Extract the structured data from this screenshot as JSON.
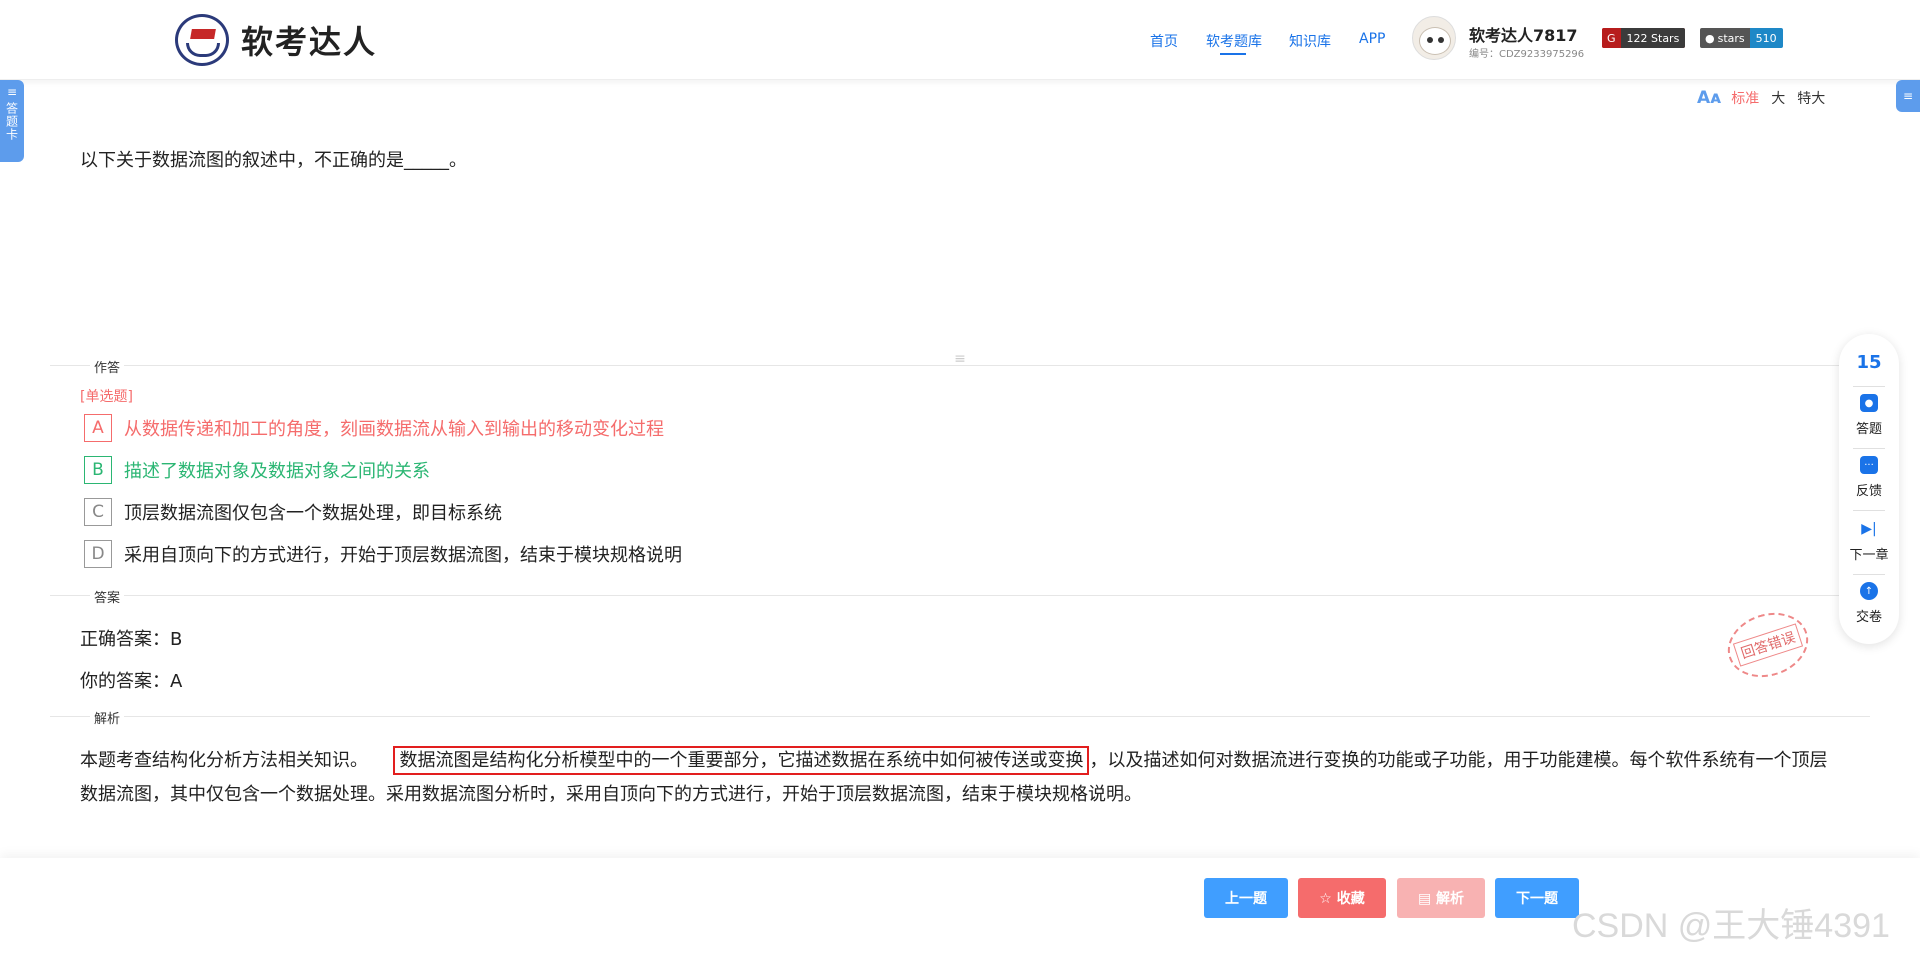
{
  "header": {
    "logo_text": "软考达人",
    "nav": [
      "首页",
      "软考题库",
      "知识库",
      "APP"
    ],
    "user_name": "软考达人7817",
    "user_id": "编号：CDZ9233975296",
    "badge1": {
      "label": "122 Stars",
      "color": "#c62828"
    },
    "badge2": {
      "left": "stars",
      "right": "510",
      "left_color": "#555555",
      "right_color": "#1e88c7"
    }
  },
  "side": {
    "left_tab": "答题卡"
  },
  "font_switch": {
    "options": [
      "标准",
      "大",
      "特大"
    ],
    "active": "标准"
  },
  "question": {
    "text": "以下关于数据流图的叙述中，不正确的是_____。",
    "section_answer": "作答",
    "type": "[单选题]",
    "options": [
      {
        "letter": "A",
        "text": "从数据传递和加工的角度，刻画数据流从输入到输出的移动变化过程",
        "state": "wrong"
      },
      {
        "letter": "B",
        "text": "描述了数据对象及数据对象之间的关系",
        "state": "right"
      },
      {
        "letter": "C",
        "text": "顶层数据流图仅包含一个数据处理，即目标系统",
        "state": "normal"
      },
      {
        "letter": "D",
        "text": "采用自顶向下的方式进行，开始于顶层数据流图，结束于模块规格说明",
        "state": "normal"
      }
    ]
  },
  "answer": {
    "section_label": "答案",
    "correct": "正确答案：B",
    "yours": "你的答案：A",
    "stamp": "回答错误"
  },
  "analysis": {
    "section_label": "解析",
    "prefix": "本题考查结构化分析方法相关知识。",
    "highlight": "数据流图是结构化分析模型中的一个重要部分，它描述数据在系统中如何被传送或变换",
    "suffix": "，以及描述如何对数据流进行变换的功能或子功能，用于功能建模。每个软件系统有一个顶层数据流图，其中仅包含一个数据处理。采用数据流图分析时，采用自顶向下的方式进行，开始于顶层数据流图，结束于模块规格说明。"
  },
  "float_panel": {
    "count": "15",
    "items": [
      "答题",
      "反馈",
      "下一章",
      "交卷"
    ]
  },
  "bottom": {
    "prev": "上一题",
    "fav": "☆ 收藏",
    "parse": "▤ 解析",
    "next": "下一题",
    "colors": {
      "blue": "#409eff",
      "red": "#f56c6c",
      "pink": "#f8b2b2"
    }
  },
  "watermark": "CSDN @王大锤4391"
}
